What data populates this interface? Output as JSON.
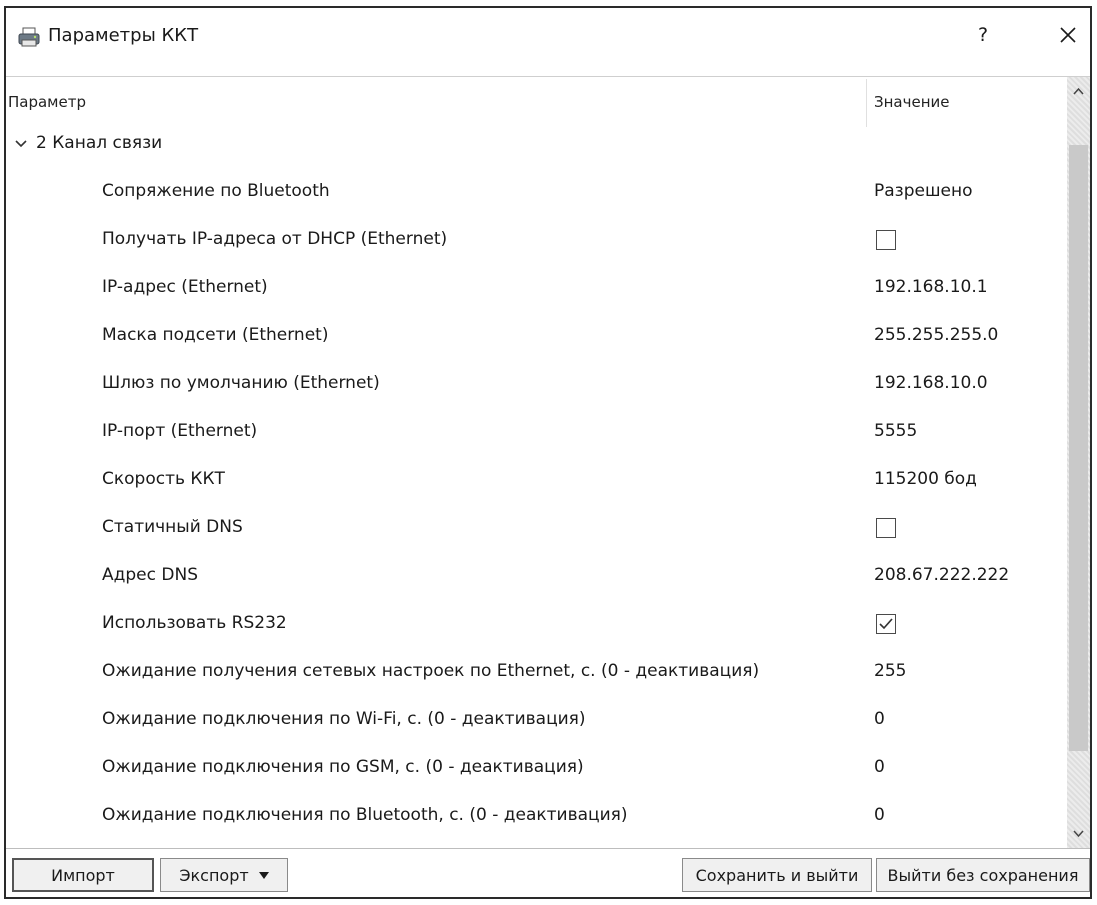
{
  "window": {
    "title": "Параметры ККТ",
    "help": "?"
  },
  "table": {
    "headers": {
      "param": "Параметр",
      "value": "Значение"
    },
    "group": {
      "label": "2 Канал связи",
      "expanded": true
    },
    "rows": [
      {
        "name": "Сопряжение по Bluetooth",
        "value": "Разрешено",
        "type": "text"
      },
      {
        "name": "Получать IP-адреса от DHCP (Ethernet)",
        "value": "",
        "type": "checkbox",
        "checked": false
      },
      {
        "name": "IP-адрес (Ethernet)",
        "value": "192.168.10.1",
        "type": "text"
      },
      {
        "name": "Маска подсети (Ethernet)",
        "value": "255.255.255.0",
        "type": "text"
      },
      {
        "name": "Шлюз по умолчанию (Ethernet)",
        "value": "192.168.10.0",
        "type": "text"
      },
      {
        "name": "IP-порт (Ethernet)",
        "value": "5555",
        "type": "text"
      },
      {
        "name": "Скорость ККТ",
        "value": "115200 бод",
        "type": "text"
      },
      {
        "name": "Статичный DNS",
        "value": "",
        "type": "checkbox",
        "checked": false
      },
      {
        "name": "Адрес DNS",
        "value": "208.67.222.222",
        "type": "text"
      },
      {
        "name": "Использовать RS232",
        "value": "",
        "type": "checkbox",
        "checked": true
      },
      {
        "name": "Ожидание получения сетевых настроек по Ethernet, с. (0 - деактивация)",
        "value": "255",
        "type": "text"
      },
      {
        "name": "Ожидание подключения по Wi-Fi, с. (0 - деактивация)",
        "value": "0",
        "type": "text"
      },
      {
        "name": "Ожидание подключения по GSM, с. (0 - деактивация)",
        "value": "0",
        "type": "text"
      },
      {
        "name": "Ожидание подключения по Bluetooth, с. (0 - деактивация)",
        "value": "0",
        "type": "text"
      }
    ]
  },
  "buttons": {
    "import": "Импорт",
    "export": "Экспорт",
    "save_exit": "Сохранить и выйти",
    "exit_no_save": "Выйти без сохранения"
  }
}
